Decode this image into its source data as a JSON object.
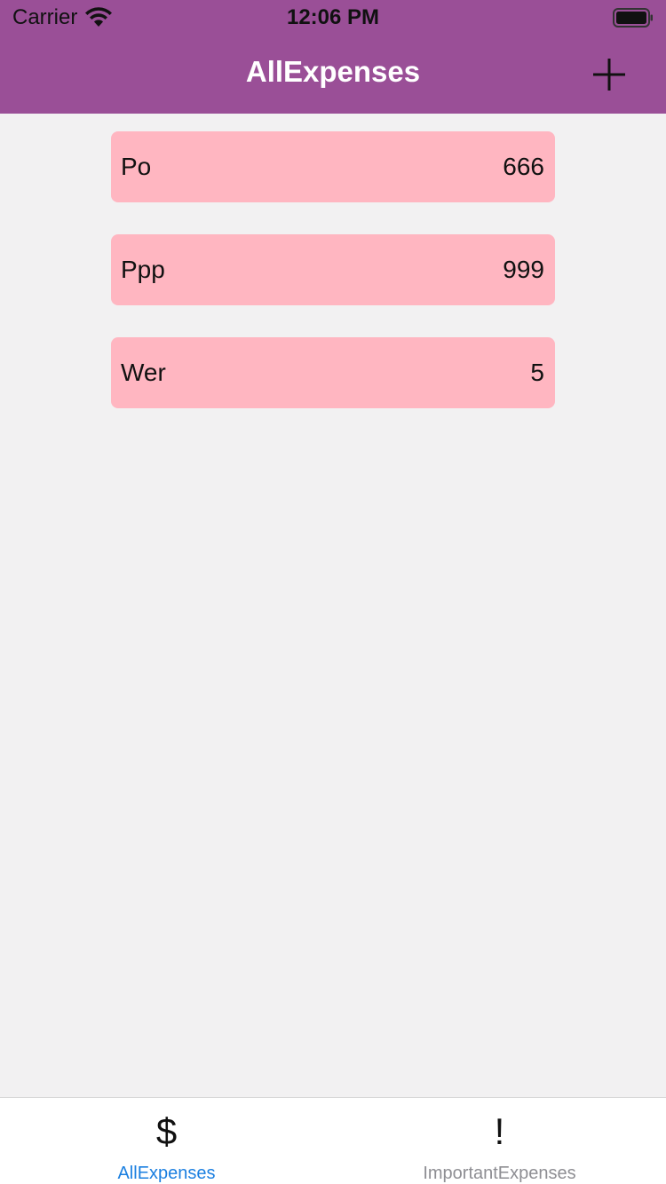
{
  "status_bar": {
    "carrier": "Carrier",
    "time": "12:06 PM"
  },
  "nav": {
    "title": "AllExpenses",
    "add_icon": "plus-icon"
  },
  "expenses": [
    {
      "name": "Po",
      "amount": "666"
    },
    {
      "name": "Ppp",
      "amount": "999"
    },
    {
      "name": "Wer",
      "amount": "5"
    }
  ],
  "tabs": [
    {
      "icon_glyph": "$",
      "icon": "dollar-icon",
      "label": "AllExpenses",
      "active": true
    },
    {
      "icon_glyph": "!",
      "icon": "exclamation-icon",
      "label": "ImportantExpenses",
      "active": false
    }
  ],
  "colors": {
    "nav_background": "#9a4f97",
    "item_background": "#ffb6c1",
    "page_background": "#f2f1f2",
    "active_tab": "#1b7fe0",
    "inactive_tab": "#8e8e93"
  }
}
